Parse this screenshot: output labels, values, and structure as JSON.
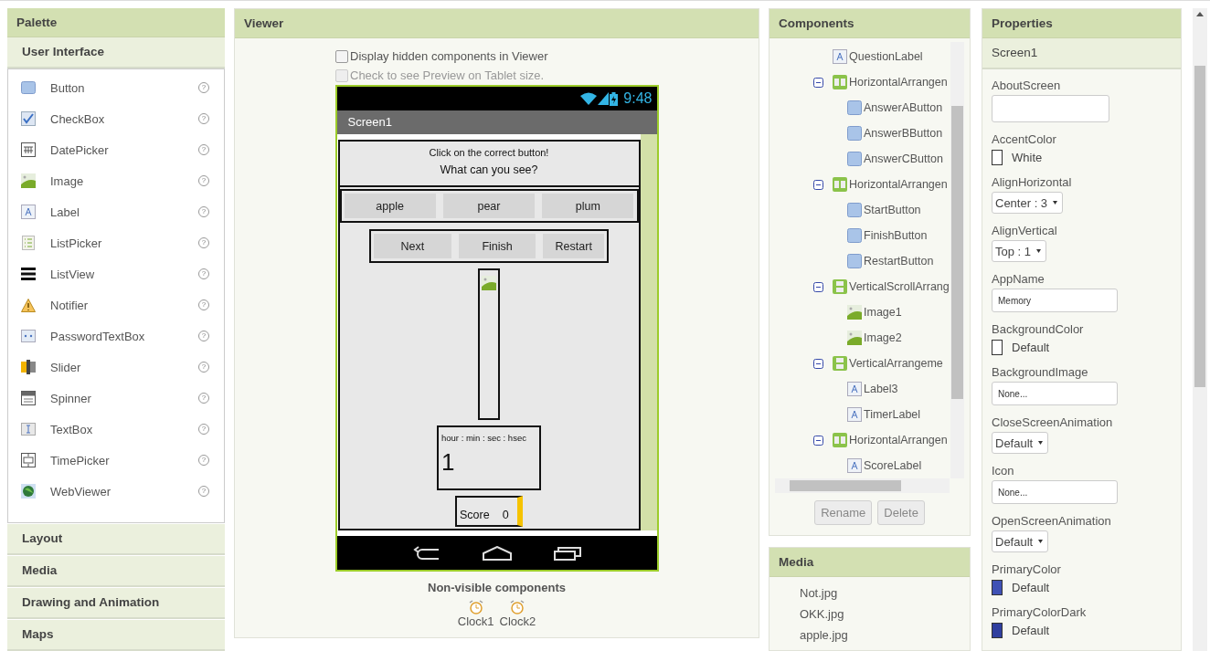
{
  "palette": {
    "title": "Palette",
    "open_section": "User Interface",
    "items": [
      {
        "label": "Button"
      },
      {
        "label": "CheckBox"
      },
      {
        "label": "DatePicker"
      },
      {
        "label": "Image"
      },
      {
        "label": "Label"
      },
      {
        "label": "ListPicker"
      },
      {
        "label": "ListView"
      },
      {
        "label": "Notifier"
      },
      {
        "label": "PasswordTextBox"
      },
      {
        "label": "Slider"
      },
      {
        "label": "Spinner"
      },
      {
        "label": "TextBox"
      },
      {
        "label": "TimePicker"
      },
      {
        "label": "WebViewer"
      }
    ],
    "help": "?",
    "sections": [
      "Layout",
      "Media",
      "Drawing and Animation",
      "Maps"
    ]
  },
  "viewer": {
    "title": "Viewer",
    "options": [
      {
        "label": "Display hidden components in Viewer",
        "checked": false,
        "disabled": false
      },
      {
        "label": "Check to see Preview on Tablet size.",
        "checked": false,
        "disabled": true
      }
    ],
    "phone": {
      "time": "9:48",
      "screen_title": "Screen1",
      "instruction": "Click on the correct button!",
      "question": "What can you see?",
      "answers": [
        "apple",
        "pear",
        "plum"
      ],
      "controls": [
        "Next",
        "Finish",
        "Restart"
      ],
      "timer_format": "hour : min : sec : hsec",
      "timer_value": "1",
      "score_label": "Score",
      "score_value": "0"
    },
    "nonvisible": {
      "title": "Non-visible components",
      "items": [
        "Clock1",
        "Clock2"
      ]
    }
  },
  "components": {
    "title": "Components",
    "tree": [
      {
        "label": "QuestionLabel",
        "kind": "label"
      },
      {
        "label": "HorizontalArrangen",
        "kind": "harr",
        "expanded": true,
        "children": [
          {
            "label": "AnswerAButton",
            "kind": "button"
          },
          {
            "label": "AnswerBButton",
            "kind": "button"
          },
          {
            "label": "AnswerCButton",
            "kind": "button"
          }
        ]
      },
      {
        "label": "HorizontalArrangen",
        "kind": "harr",
        "expanded": true,
        "children": [
          {
            "label": "StartButton",
            "kind": "button"
          },
          {
            "label": "FinishButton",
            "kind": "button"
          },
          {
            "label": "RestartButton",
            "kind": "button"
          }
        ]
      },
      {
        "label": "VerticalScrollArrang",
        "kind": "varr",
        "expanded": true,
        "children": [
          {
            "label": "Image1",
            "kind": "image"
          },
          {
            "label": "Image2",
            "kind": "image"
          }
        ]
      },
      {
        "label": "VerticalArrangeme",
        "kind": "varr",
        "expanded": true,
        "children": [
          {
            "label": "Label3",
            "kind": "label"
          },
          {
            "label": "TimerLabel",
            "kind": "label"
          }
        ]
      },
      {
        "label": "HorizontalArrangen",
        "kind": "harr",
        "expanded": true,
        "children": [
          {
            "label": "ScoreLabel",
            "kind": "label"
          }
        ]
      }
    ],
    "buttons": [
      "Rename",
      "Delete"
    ]
  },
  "media": {
    "title": "Media",
    "files": [
      "Not.jpg",
      "OKK.jpg",
      "apple.jpg"
    ]
  },
  "properties": {
    "title": "Properties",
    "component": "Screen1",
    "items": [
      {
        "label": "AboutScreen",
        "kind": "textarea"
      },
      {
        "label": "AccentColor",
        "kind": "color",
        "value": "White",
        "color": "#ffffff"
      },
      {
        "label": "AlignHorizontal",
        "kind": "dropdown",
        "value": "Center : 3"
      },
      {
        "label": "AlignVertical",
        "kind": "dropdown",
        "value": "Top : 1"
      },
      {
        "label": "AppName",
        "kind": "text",
        "value": "Memory"
      },
      {
        "label": "BackgroundColor",
        "kind": "color",
        "value": "Default",
        "color": "#ffffff"
      },
      {
        "label": "BackgroundImage",
        "kind": "text",
        "value": "None..."
      },
      {
        "label": "CloseScreenAnimation",
        "kind": "dropdown",
        "value": "Default"
      },
      {
        "label": "Icon",
        "kind": "text",
        "value": "None..."
      },
      {
        "label": "OpenScreenAnimation",
        "kind": "dropdown",
        "value": "Default"
      },
      {
        "label": "PrimaryColor",
        "kind": "color",
        "value": "Default",
        "color": "#3f51b5"
      },
      {
        "label": "PrimaryColorDark",
        "kind": "color",
        "value": "Default",
        "color": "#303f9f"
      }
    ]
  }
}
